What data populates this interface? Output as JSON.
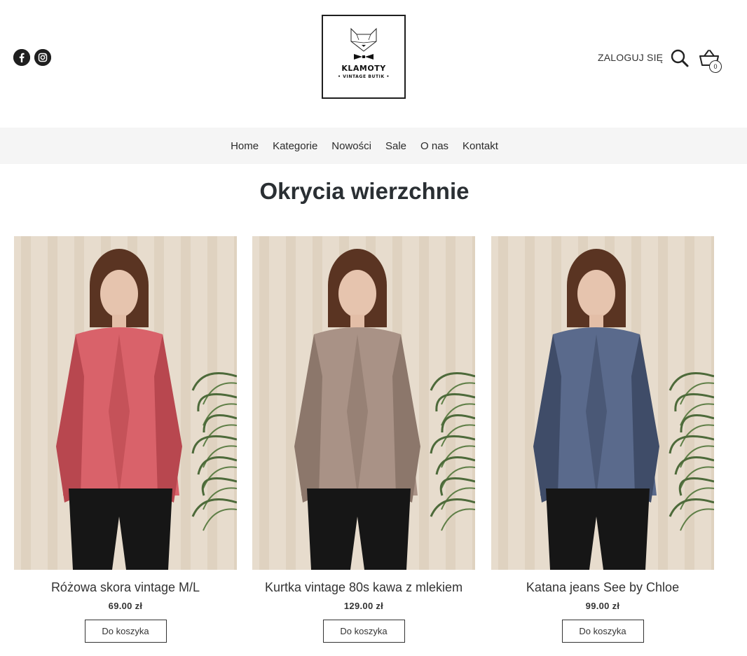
{
  "header": {
    "social": [
      {
        "name": "facebook",
        "glyph": "f"
      },
      {
        "name": "instagram",
        "glyph": ""
      }
    ],
    "logo": {
      "brand": "KLAMOTY",
      "sub": "• VINTAGE BUTIK •"
    },
    "login_label": "ZALOGUJ SIĘ",
    "cart_count": "0"
  },
  "nav": {
    "items": [
      "Home",
      "Kategorie",
      "Nowości",
      "Sale",
      "O nas",
      "Kontakt"
    ]
  },
  "page_title": "Okrycia wierzchnie",
  "products": [
    {
      "name": "Różowa skora vintage M/L",
      "price": "69.00 zł",
      "button": "Do koszyka",
      "colors": {
        "jacket": "#d9626a",
        "jacket_shadow": "#b8474f",
        "pants": "#161616",
        "hair": "#5a3422"
      }
    },
    {
      "name": "Kurtka vintage 80s kawa z mlekiem",
      "price": "129.00 zł",
      "button": "Do koszyka",
      "colors": {
        "jacket": "#a99286",
        "jacket_shadow": "#8c776b",
        "pants": "#161616",
        "hair": "#5a3422"
      }
    },
    {
      "name": "Katana jeans See by Chloe",
      "price": "99.00 zł",
      "button": "Do koszyka",
      "colors": {
        "jacket": "#5a6a8c",
        "jacket_shadow": "#3f4c68",
        "pants": "#161616",
        "hair": "#5a3422"
      }
    }
  ],
  "colors": {
    "background_curtain": "#e7dccd",
    "curtain_fold": "#d8cab7",
    "nav_bg": "#f5f5f5",
    "text": "#2b2b2b"
  }
}
